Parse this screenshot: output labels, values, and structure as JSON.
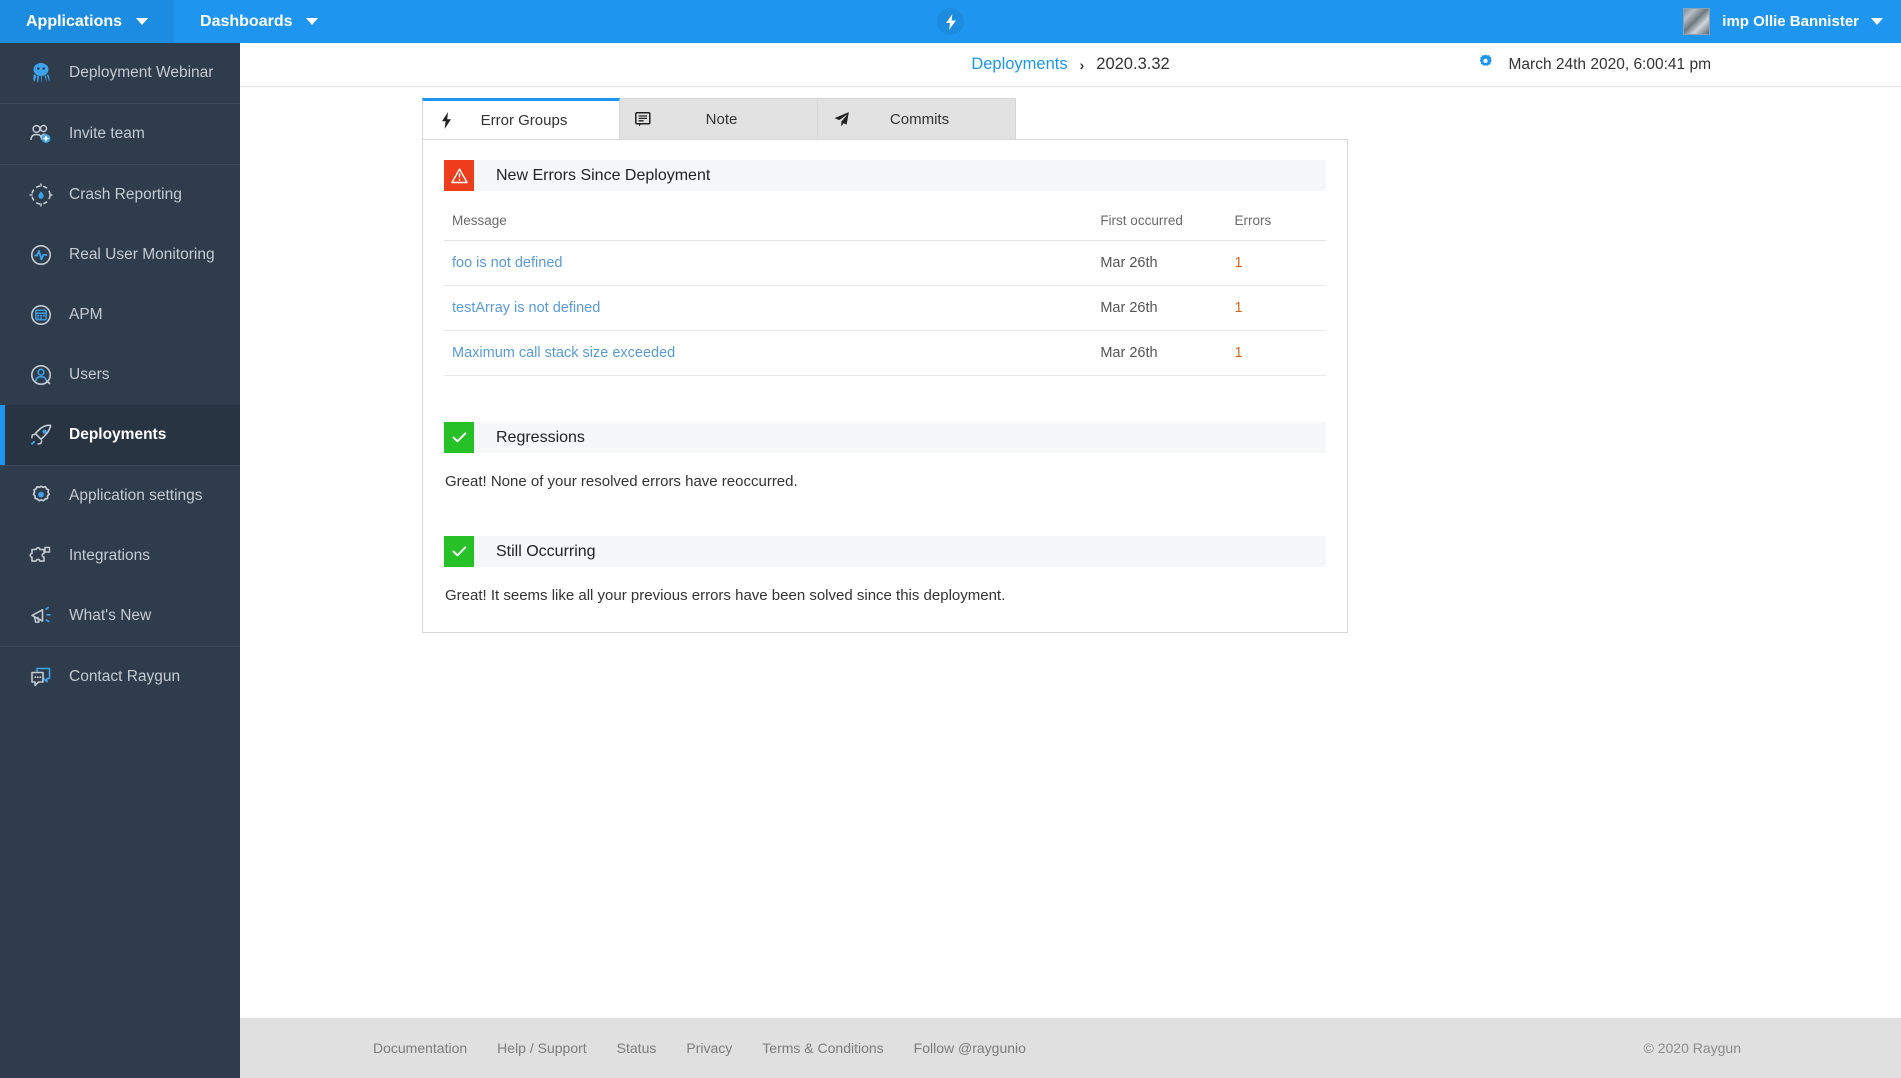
{
  "topnav": {
    "applications_label": "Applications",
    "dashboards_label": "Dashboards",
    "logo_icon": "raygun-bolt-icon",
    "username": "imp Ollie Bannister",
    "accent_color": "#1e96ef"
  },
  "sidebar": {
    "groups": [
      {
        "items": [
          {
            "label": "Deployment Webinar",
            "icon": "octopus-icon",
            "active": false
          }
        ]
      },
      {
        "items": [
          {
            "label": "Invite team",
            "icon": "invite-team-icon",
            "active": false
          }
        ]
      },
      {
        "items": [
          {
            "label": "Crash Reporting",
            "icon": "crash-reporting-icon",
            "active": false
          },
          {
            "label": "Real User Monitoring",
            "icon": "pulse-icon",
            "active": false
          },
          {
            "label": "APM",
            "icon": "apm-icon",
            "active": false
          },
          {
            "label": "Users",
            "icon": "users-icon",
            "active": false
          },
          {
            "label": "Deployments",
            "icon": "rocket-icon",
            "active": true
          }
        ]
      },
      {
        "items": [
          {
            "label": "Application settings",
            "icon": "gear-icon",
            "active": false
          },
          {
            "label": "Integrations",
            "icon": "puzzle-icon",
            "active": false
          },
          {
            "label": "What's New",
            "icon": "megaphone-icon",
            "active": false
          }
        ]
      },
      {
        "items": [
          {
            "label": "Contact Raygun",
            "icon": "chat-icon",
            "active": false
          }
        ]
      }
    ]
  },
  "header": {
    "breadcrumb_parent": "Deployments",
    "breadcrumb_separator": "›",
    "breadcrumb_current": "2020.3.32",
    "settings_icon": "gear-icon",
    "date": "March 24th 2020, 6:00:41 pm"
  },
  "tabs": [
    {
      "label": "Error Groups",
      "icon": "bolt-icon",
      "active": true
    },
    {
      "label": "Note",
      "icon": "note-icon",
      "active": false
    },
    {
      "label": "Commits",
      "icon": "paper-plane-icon",
      "active": false
    }
  ],
  "new_errors": {
    "title": "New Errors Since Deployment",
    "badge_icon": "warning-triangle-icon",
    "badge_color": "#ee3d1c",
    "columns": [
      "Message",
      "First occurred",
      "Errors"
    ],
    "rows": [
      {
        "message": "foo is not defined",
        "first_occurred": "Mar 26th",
        "errors": "1"
      },
      {
        "message": "testArray is not defined",
        "first_occurred": "Mar 26th",
        "errors": "1"
      },
      {
        "message": "Maximum call stack size exceeded",
        "first_occurred": "Mar 26th",
        "errors": "1"
      }
    ]
  },
  "regressions": {
    "title": "Regressions",
    "badge_icon": "check-icon",
    "badge_color": "#25c126",
    "note": "Great! None of your resolved errors have reoccurred."
  },
  "still_occurring": {
    "title": "Still Occurring",
    "badge_icon": "check-icon",
    "badge_color": "#25c126",
    "note": "Great! It seems like all your previous errors have been solved since this deployment."
  },
  "footer": {
    "links": [
      "Documentation",
      "Help / Support",
      "Status",
      "Privacy",
      "Terms & Conditions",
      "Follow @raygunio"
    ],
    "copyright": "© 2020 Raygun"
  }
}
